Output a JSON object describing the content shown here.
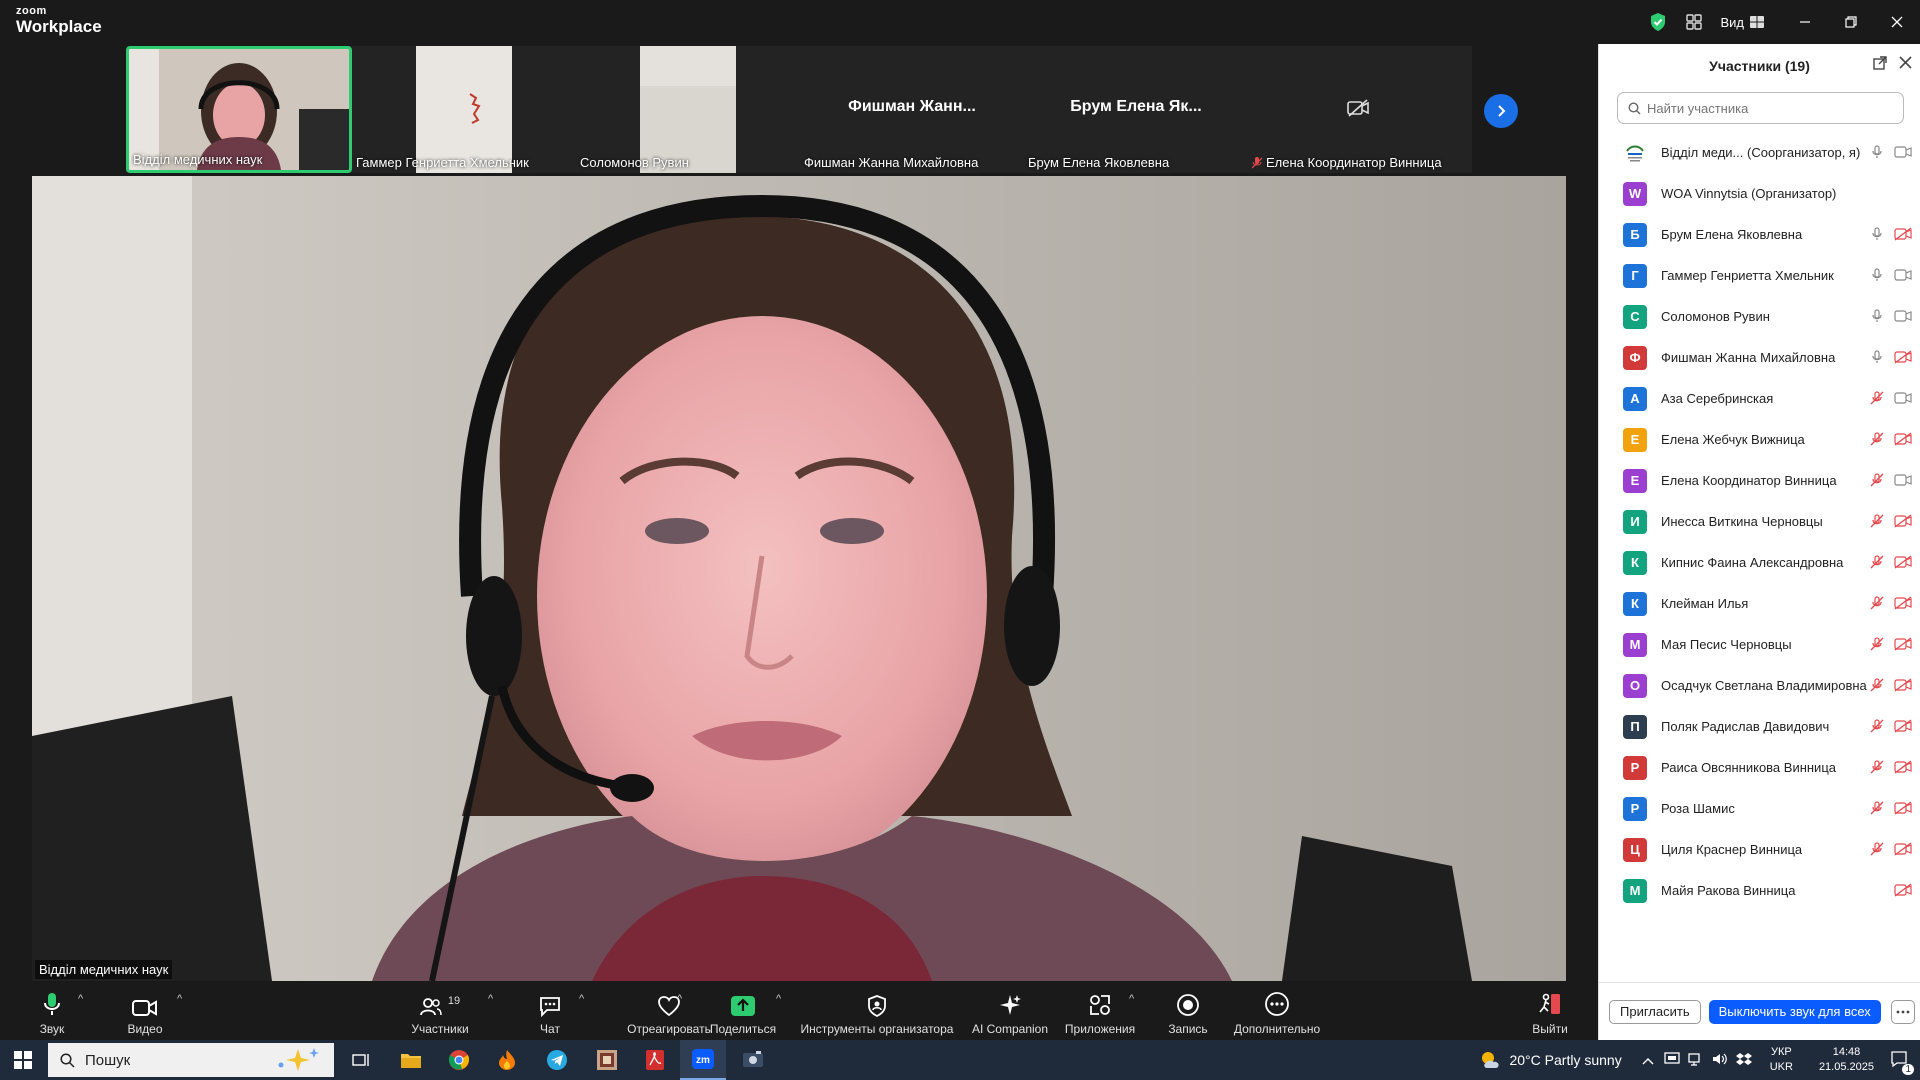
{
  "app": {
    "brand_small": "zoom",
    "brand_title": "Workplace",
    "view_label": "Вид"
  },
  "strip": {
    "thumbs": [
      {
        "name": "Відділ медичних наук",
        "big": ""
      },
      {
        "name": "Гаммер Генриетта Хмельник",
        "big": ""
      },
      {
        "name": "Соломонов Рувин",
        "big": ""
      },
      {
        "name": "Фишман Жанна Михайловна",
        "big": "Фишман Жанн..."
      },
      {
        "name": "Брум Елена Яковлевна",
        "big": "Брум Елена Як..."
      },
      {
        "name": "Елена Координатор Винница",
        "big": ""
      }
    ]
  },
  "main": {
    "speaker_name": "Відділ медичних наук"
  },
  "toolbar": {
    "audio": "Звук",
    "video": "Видео",
    "participants": "Участники",
    "participants_count": "19",
    "chat": "Чат",
    "react": "Отреагировать",
    "share": "Поделиться",
    "host_tools": "Инструменты организатора",
    "ai": "AI Companion",
    "apps": "Приложения",
    "record": "Запись",
    "more": "Дополнительно",
    "leave": "Выйти"
  },
  "panel": {
    "title": "Участники (19)",
    "search_placeholder": "Найти участника",
    "participants": [
      {
        "initial": "",
        "name": "Відділ меди...  (Соорганизатор, я)",
        "color": "#ffffff",
        "mic": "on",
        "cam": "on",
        "logo": true
      },
      {
        "initial": "W",
        "name": "WOA Vinnytsia (Организатор)",
        "color": "#9b3fd1",
        "mic": "none",
        "cam": "none"
      },
      {
        "initial": "Б",
        "name": "Брум Елена Яковлевна",
        "color": "#1e73d8",
        "mic": "on",
        "cam": "off"
      },
      {
        "initial": "Г",
        "name": "Гаммер Генриетта Хмельник",
        "color": "#1e73d8",
        "mic": "on",
        "cam": "on"
      },
      {
        "initial": "С",
        "name": "Соломонов Рувин",
        "color": "#14a37f",
        "mic": "on",
        "cam": "on"
      },
      {
        "initial": "Ф",
        "name": "Фишман Жанна Михайловна",
        "color": "#d23a3a",
        "mic": "on",
        "cam": "off"
      },
      {
        "initial": "А",
        "name": "Аза Серебринская",
        "color": "#1e73d8",
        "mic": "off",
        "cam": "on"
      },
      {
        "initial": "Е",
        "name": "Елена Жебчук Вижница",
        "color": "#f2a20c",
        "mic": "off",
        "cam": "off"
      },
      {
        "initial": "Е",
        "name": "Елена Координатор Винница",
        "color": "#9b3fd1",
        "mic": "off",
        "cam": "on"
      },
      {
        "initial": "И",
        "name": "Инесса Виткина Черновцы",
        "color": "#14a37f",
        "mic": "off",
        "cam": "off"
      },
      {
        "initial": "К",
        "name": "Кипнис Фаина Александровна",
        "color": "#14a37f",
        "mic": "off",
        "cam": "off"
      },
      {
        "initial": "К",
        "name": "Клейман Илья",
        "color": "#1e73d8",
        "mic": "off",
        "cam": "off"
      },
      {
        "initial": "М",
        "name": "Мая Песис Черновцы",
        "color": "#9b3fd1",
        "mic": "off",
        "cam": "off"
      },
      {
        "initial": "О",
        "name": "Осадчук Светлана Владимировна",
        "color": "#9b3fd1",
        "mic": "off",
        "cam": "off"
      },
      {
        "initial": "П",
        "name": "Поляк Радислав Давидович",
        "color": "#2c3e50",
        "mic": "off",
        "cam": "off"
      },
      {
        "initial": "Р",
        "name": "Раиса Овсянникова Винница",
        "color": "#d23a3a",
        "mic": "off",
        "cam": "off"
      },
      {
        "initial": "Р",
        "name": "Роза Шамис",
        "color": "#1e73d8",
        "mic": "off",
        "cam": "off"
      },
      {
        "initial": "Ц",
        "name": "Циля Краснер Винница",
        "color": "#d23a3a",
        "mic": "off",
        "cam": "off"
      },
      {
        "initial": "М",
        "name": "Майя Ракова Винница",
        "color": "#14a37f",
        "mic": "none",
        "cam": "off"
      }
    ],
    "invite_label": "Пригласить",
    "mute_all_label": "Выключить звук для всех"
  },
  "taskbar": {
    "search_text": "Пошук",
    "weather": "20°C  Partly sunny",
    "lang_top": "УКР",
    "lang_bottom": "UKR",
    "time": "14:48",
    "date": "21.05.2025",
    "notif_count": "1"
  },
  "colors": {
    "accent": "#0b5cff",
    "active_border": "#2ecc71",
    "muted": "#e5484d"
  }
}
